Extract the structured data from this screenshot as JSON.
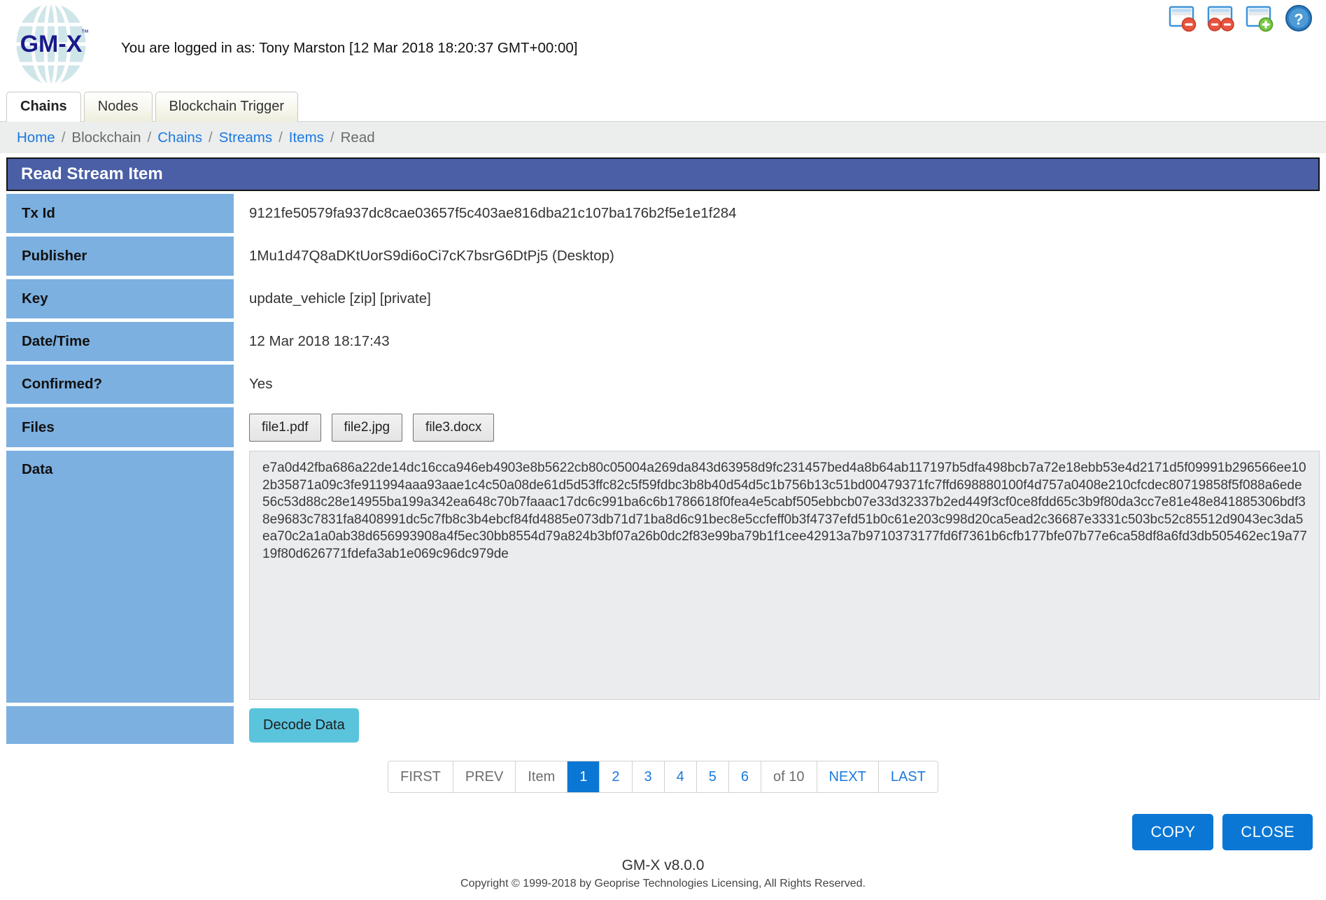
{
  "header": {
    "logo_text": "GM-X",
    "logo_tm": "™",
    "login_status": "You are logged in as: Tony Marston [12 Mar 2018 18:20:37 GMT+00:00]",
    "icons": [
      {
        "name": "close-window-icon",
        "title": "Close window"
      },
      {
        "name": "close-all-windows-icon",
        "title": "Close all windows"
      },
      {
        "name": "new-window-icon",
        "title": "New window"
      },
      {
        "name": "help-icon",
        "title": "Help"
      }
    ]
  },
  "tabs": [
    {
      "label": "Chains",
      "active": true
    },
    {
      "label": "Nodes",
      "active": false
    },
    {
      "label": "Blockchain Trigger",
      "active": false
    }
  ],
  "breadcrumb": [
    {
      "label": "Home",
      "link": true
    },
    {
      "label": "Blockchain",
      "link": false
    },
    {
      "label": "Chains",
      "link": true
    },
    {
      "label": "Streams",
      "link": true
    },
    {
      "label": "Items",
      "link": true
    },
    {
      "label": "Read",
      "link": false
    }
  ],
  "breadcrumb_separator": "/",
  "page_title": "Read Stream Item",
  "fields": {
    "tx_id_label": "Tx Id",
    "tx_id_value": "9121fe50579fa937dc8cae03657f5c403ae816dba21c107ba176b2f5e1e1f284",
    "publisher_label": "Publisher",
    "publisher_value": "1Mu1d47Q8aDKtUorS9di6oCi7cK7bsrG6DtPj5 (Desktop)",
    "key_label": "Key",
    "key_value": "update_vehicle [zip] [private]",
    "datetime_label": "Date/Time",
    "datetime_value": "12 Mar 2018 18:17:43",
    "confirmed_label": "Confirmed?",
    "confirmed_value": "Yes",
    "files_label": "Files",
    "data_label": "Data",
    "data_value": "e7a0d42fba686a22de14dc16cca946eb4903e8b5622cb80c05004a269da843d63958d9fc231457bed4a8b64ab117197b5dfa498bcb7a72e18ebb53e4d2171d5f09991b296566ee102b35871a09c3fe911994aaa93aae1c4c50a08de61d5d53ffc82c5f59fdbc3b8b40d54d5c1b756b13c51bd00479371fc7ffd698880100f4d757a0408e210cfcdec80719858f5f088a6ede56c53d88c28e14955ba199a342ea648c70b7faaac17dc6c991ba6c6b1786618f0fea4e5cabf505ebbcb07e33d32337b2ed449f3cf0ce8fdd65c3b9f80da3cc7e81e48e841885306bdf38e9683c7831fa8408991dc5c7fb8c3b4ebcf84fd4885e073db71d71ba8d6c91bec8e5ccfeff0b3f4737efd51b0c61e203c998d20ca5ead2c36687e3331c503bc52c85512d9043ec3da5ea70c2a1a0ab38d656993908a4f5ec30bb8554d79a824b3bf07a26b0dc2f83e99ba79b1f1cee42913a7b9710373177fd6f7361b6cfb177bfe07b77e6ca58df8a6fd3db505462ec19a7719f80d626771fdefa3ab1e069c96dc979de"
  },
  "files": [
    {
      "label": "file1.pdf"
    },
    {
      "label": "file2.jpg"
    },
    {
      "label": "file3.docx"
    }
  ],
  "decode_button": "Decode Data",
  "pagination": {
    "first": "FIRST",
    "prev": "PREV",
    "item": "Item",
    "pages": [
      "1",
      "2",
      "3",
      "4",
      "5",
      "6"
    ],
    "active_page": "1",
    "of_total": "of 10",
    "next": "NEXT",
    "last": "LAST"
  },
  "actions": {
    "copy": "COPY",
    "close": "CLOSE"
  },
  "footer": {
    "version": "GM-X v8.0.0",
    "copyright": "Copyright © 1999-2018 by Geoprise Technologies Licensing, All Rights Reserved."
  },
  "colors": {
    "title_bar": "#4a5fa5",
    "label_cell": "#7cb0e0",
    "link": "#1a7ae0",
    "primary_button": "#0a77d5",
    "decode_button": "#5bc4dd",
    "logo_text": "#1a1a8c"
  }
}
